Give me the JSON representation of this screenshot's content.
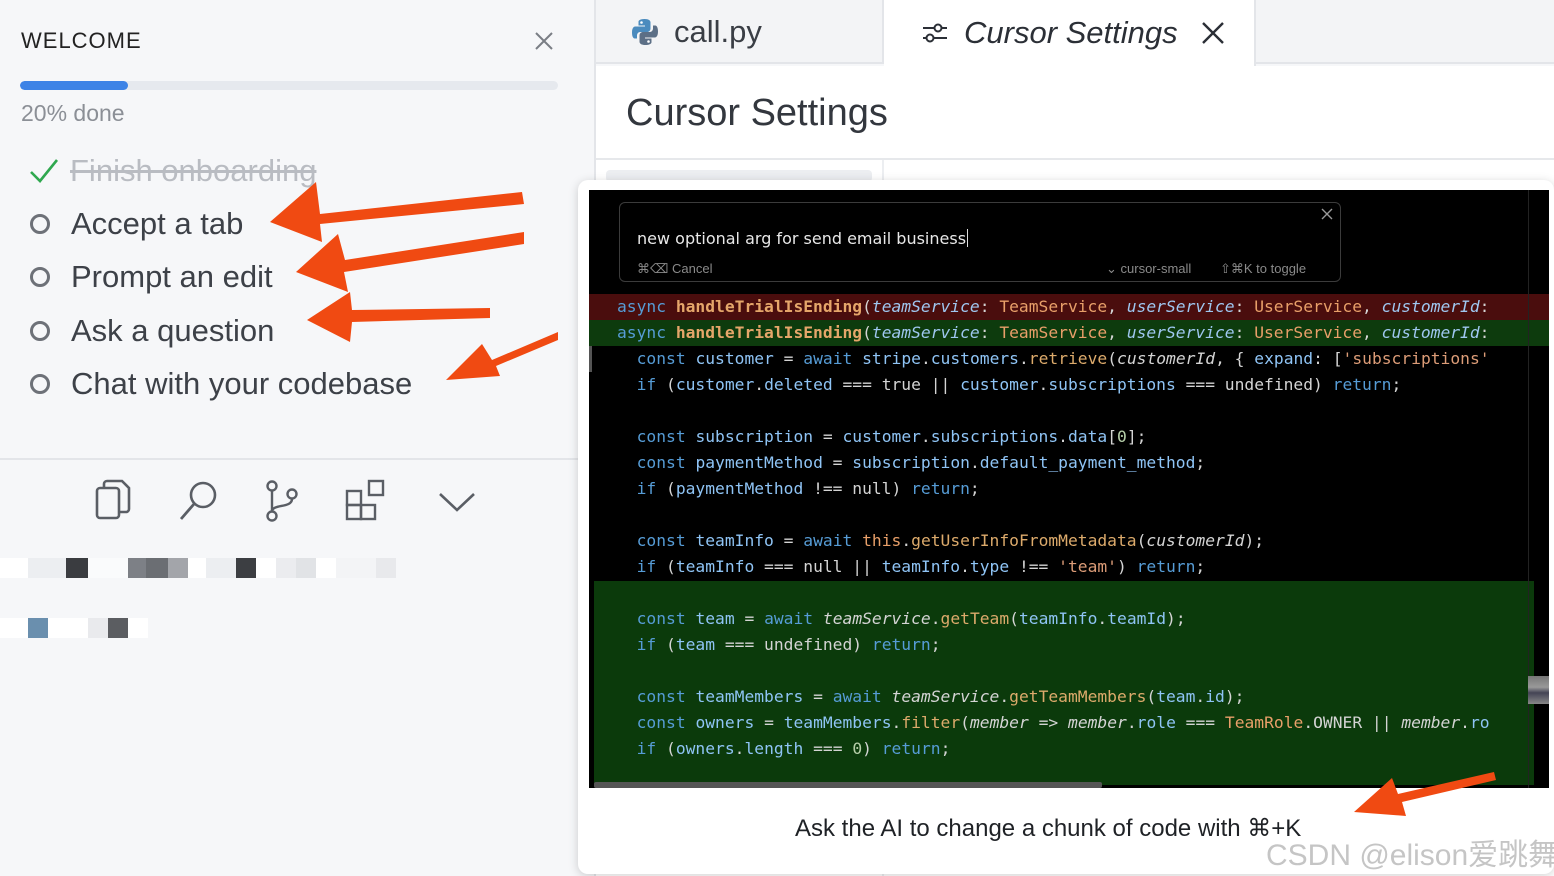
{
  "welcome": {
    "title": "WELCOME",
    "progress_fraction": 0.2,
    "progress_label": "20% done",
    "tasks": [
      {
        "label": "Finish onboarding",
        "done": true
      },
      {
        "label": "Accept a tab",
        "done": false
      },
      {
        "label": "Prompt an edit",
        "done": false
      },
      {
        "label": "Ask a question",
        "done": false
      },
      {
        "label": "Chat with your codebase",
        "done": false
      }
    ]
  },
  "activity_icons": [
    "files-icon",
    "search-icon",
    "source-control-icon",
    "extensions-icon",
    "chevron-down-icon"
  ],
  "tabs": [
    {
      "label": "call.py",
      "icon": "python-icon"
    },
    {
      "label": "Cursor Settings",
      "icon": "settings-sliders-icon"
    }
  ],
  "settings": {
    "title": "Cursor Settings"
  },
  "prompt": {
    "value": "new optional arg for send email business",
    "cancel": "⌘⌫ Cancel",
    "model": "⌄ cursor-small",
    "toggle": "⇧⌘K to toggle"
  },
  "card_caption": "Ask the AI to change a chunk of code with ⌘+K",
  "watermark": "CSDN @elison爱跳舞",
  "colors": {
    "accent": "#3d83e6",
    "annotation_arrow": "#f04a12",
    "code_bg": "#000000",
    "diff_removed": "#4a0d0d",
    "diff_added": "#0d3b0d"
  }
}
